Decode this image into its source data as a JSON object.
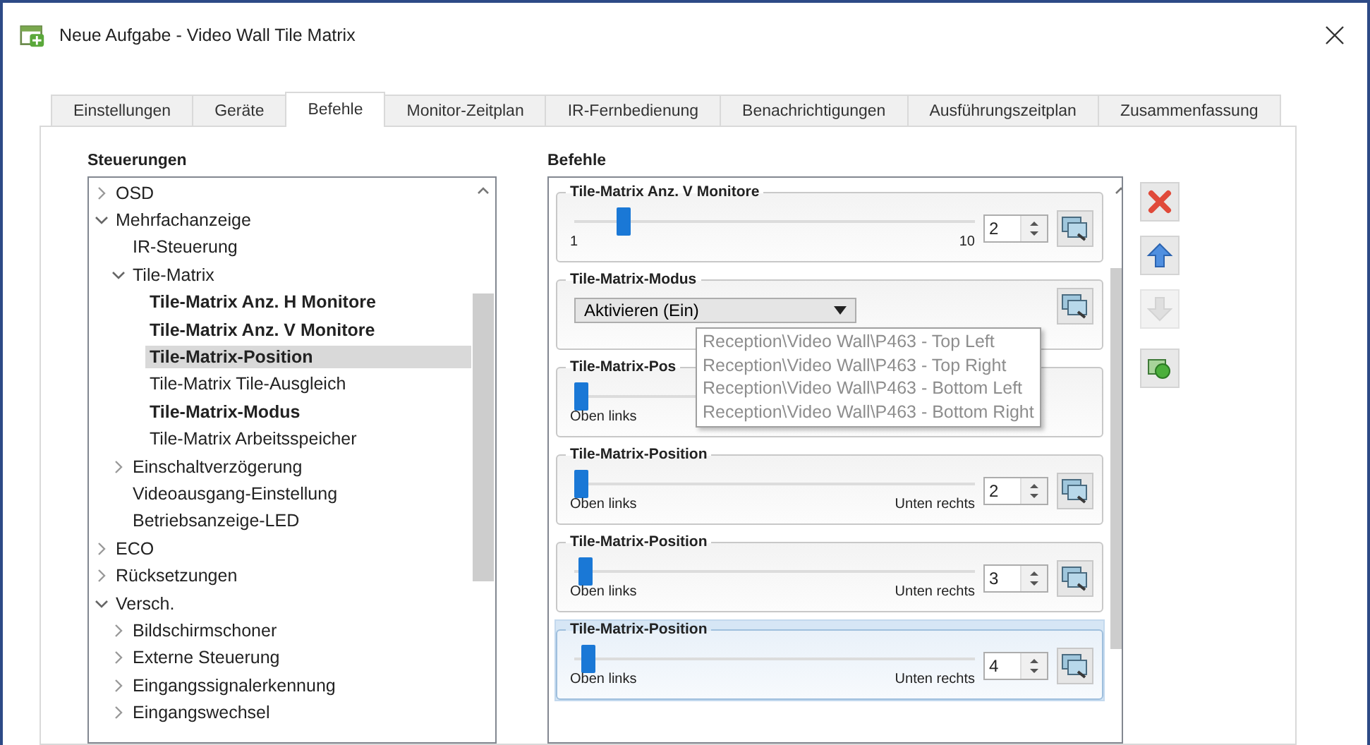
{
  "window": {
    "title": "Neue Aufgabe - Video Wall Tile Matrix"
  },
  "tabs": [
    {
      "label": "Einstellungen",
      "selected": false
    },
    {
      "label": "Geräte",
      "selected": false
    },
    {
      "label": "Befehle",
      "selected": true
    },
    {
      "label": "Monitor-Zeitplan",
      "selected": false
    },
    {
      "label": "IR-Fernbedienung",
      "selected": false
    },
    {
      "label": "Benachrichtigungen",
      "selected": false
    },
    {
      "label": "Ausführungszeitplan",
      "selected": false
    },
    {
      "label": "Zusammenfassung",
      "selected": false
    }
  ],
  "controls_panel": {
    "title": "Steuerungen",
    "tree": [
      {
        "label": "OSD",
        "expanded": false,
        "selected": false
      },
      {
        "label": "Mehrfachanzeige",
        "expanded": true,
        "selected": false,
        "children": [
          {
            "label": "IR-Steuerung",
            "selected": false
          },
          {
            "label": "Tile-Matrix",
            "expanded": true,
            "selected": false,
            "children": [
              {
                "label": "Tile-Matrix Anz. H Monitore",
                "bold": true,
                "selected": false
              },
              {
                "label": "Tile-Matrix Anz. V Monitore",
                "bold": true,
                "selected": false
              },
              {
                "label": "Tile-Matrix-Position",
                "bold": true,
                "selected": true
              },
              {
                "label": "Tile-Matrix Tile-Ausgleich",
                "bold": false,
                "selected": false
              },
              {
                "label": "Tile-Matrix-Modus",
                "bold": true,
                "selected": false
              },
              {
                "label": "Tile-Matrix Arbeitsspeicher",
                "bold": false,
                "selected": false
              }
            ]
          },
          {
            "label": "Einschaltverzögerung",
            "expanded": false,
            "selected": false
          },
          {
            "label": "Videoausgang-Einstellung",
            "selected": false
          },
          {
            "label": "Betriebsanzeige-LED",
            "selected": false
          }
        ]
      },
      {
        "label": "ECO",
        "expanded": false,
        "selected": false
      },
      {
        "label": "Rücksetzungen",
        "expanded": false,
        "selected": false
      },
      {
        "label": "Versch.",
        "expanded": true,
        "selected": false,
        "children": [
          {
            "label": "Bildschirmschoner",
            "expanded": false,
            "selected": false
          },
          {
            "label": "Externe Steuerung",
            "expanded": false,
            "selected": false
          },
          {
            "label": "Eingangssignalerkennung",
            "expanded": false,
            "selected": false
          },
          {
            "label": "Eingangswechsel",
            "expanded": false,
            "selected": false
          }
        ]
      }
    ]
  },
  "commands_panel": {
    "title": "Befehle",
    "commands": [
      {
        "kind": "slider",
        "title": "Tile-Matrix Anz. V Monitore",
        "level": 0.11,
        "min_label": "1",
        "max_label": "10",
        "value": "2",
        "selected": false
      },
      {
        "kind": "dropdown",
        "title": "Tile-Matrix-Modus",
        "value": "Aktivieren (Ein)",
        "selected": false
      },
      {
        "kind": "slider",
        "title": "Tile-Matrix-Pos",
        "level": 0,
        "min_label": "Oben links",
        "selected": false
      },
      {
        "kind": "slider",
        "title": "Tile-Matrix-Position",
        "level": 0,
        "min_label": "Oben links",
        "max_label": "Unten rechts",
        "value": "2",
        "selected": false
      },
      {
        "kind": "slider",
        "title": "Tile-Matrix-Position",
        "level": 0.01,
        "min_label": "Oben links",
        "max_label": "Unten rechts",
        "value": "3",
        "selected": false
      },
      {
        "kind": "slider",
        "title": "Tile-Matrix-Position",
        "level": 0.02,
        "min_label": "Oben links",
        "max_label": "Unten rechts",
        "value": "4",
        "selected": true
      }
    ],
    "popup": {
      "items": [
        "Reception\\Video Wall\\P463 - Top Left",
        "Reception\\Video Wall\\P463 - Top Right",
        "Reception\\Video Wall\\P463 - Bottom Left",
        "Reception\\Video Wall\\P463 - Bottom Right"
      ]
    }
  },
  "side_buttons": [
    {
      "kind": "delete",
      "disabled": false
    },
    {
      "kind": "up",
      "disabled": false
    },
    {
      "kind": "down",
      "disabled": true
    },
    {
      "kind": "refresh",
      "disabled": false
    }
  ]
}
